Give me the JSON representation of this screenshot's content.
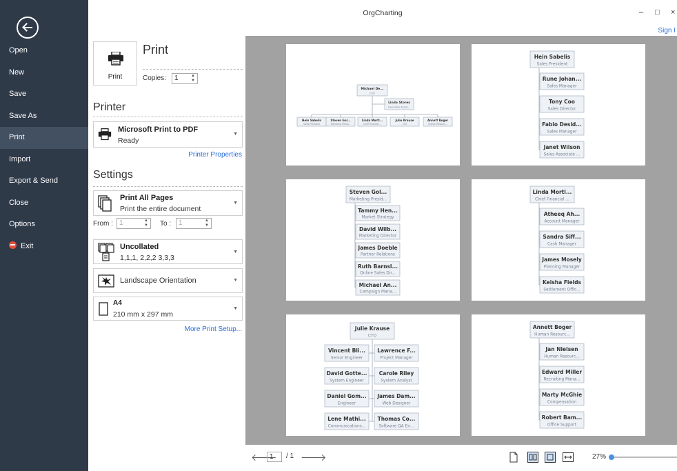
{
  "sidebar": {
    "items": [
      {
        "label": "Open"
      },
      {
        "label": "New"
      },
      {
        "label": "Save"
      },
      {
        "label": "Save As"
      },
      {
        "label": "Print",
        "active": true
      },
      {
        "label": "Import"
      },
      {
        "label": "Export & Send"
      },
      {
        "label": "Close"
      },
      {
        "label": "Options"
      },
      {
        "label": "Exit",
        "icon": "exit-icon"
      }
    ]
  },
  "window": {
    "title": "OrgCharting",
    "minimize": "–",
    "maximize": "□",
    "close": "×",
    "sign_in": "Sign I"
  },
  "print": {
    "button_label": "Print",
    "title": "Print",
    "copies_label": "Copies:",
    "copies_value": "1"
  },
  "printer": {
    "heading": "Printer",
    "name": "Microsoft Print to PDF",
    "status": "Ready",
    "properties_link": "Printer Properties"
  },
  "settings": {
    "heading": "Settings",
    "pages_title": "Print All Pages",
    "pages_sub": "Print the entire document",
    "from_label": "From :",
    "from_value": "1",
    "to_label": "To :",
    "to_value": "1",
    "collate_title": "Uncollated",
    "collate_sub": "1,1,1, 2,2,2 3,3,3",
    "orientation": "Landscape Orientation",
    "paper_title": "A4",
    "paper_sub": "210 mm x 297 mm",
    "more_link": "More Print Setup..."
  },
  "statusbar": {
    "page_value": "1",
    "page_total": "/ 1",
    "zoom_label": "27%",
    "zoom_fraction": 0.04
  },
  "accent": "#2a6fdb",
  "pages": [
    {
      "type": "tree",
      "nodes": [
        {
          "id": "a",
          "name": "Michael De...",
          "title": "CEO"
        },
        {
          "id": "b",
          "name": "Linda Stores",
          "title": "Executive Assist..."
        },
        {
          "id": "c",
          "name": "Hein Sabelis",
          "title": "Sales President"
        },
        {
          "id": "d",
          "name": "Steven Gol...",
          "title": "Marketing Presid..."
        },
        {
          "id": "e",
          "name": "Linda Mortl...",
          "title": "Chief Financial ..."
        },
        {
          "id": "f",
          "name": "Julie Krause",
          "title": "CTO"
        },
        {
          "id": "g",
          "name": "Annett Boger",
          "title": "Human Resourc..."
        }
      ]
    },
    {
      "type": "list",
      "head": {
        "name": "Hein Sabelis",
        "title": "Sales President"
      },
      "children": [
        {
          "name": "Rune Johan...",
          "title": "Sales Manager"
        },
        {
          "name": "Tony Coo",
          "title": "Sales Director"
        },
        {
          "name": "Fabio Desid...",
          "title": "Sales Manager"
        },
        {
          "name": "Janet Wilson",
          "title": "Sales Associate ..."
        }
      ]
    },
    {
      "type": "list",
      "head": {
        "name": "Steven Gol...",
        "title": "Marketing Presid..."
      },
      "children": [
        {
          "name": "Tammy Hen...",
          "title": "Market Strategy"
        },
        {
          "name": "David Wilb...",
          "title": "Marketing Director"
        },
        {
          "name": "James Doeble",
          "title": "Partner Relations"
        },
        {
          "name": "Ruth Barnsl...",
          "title": "Online Sales Dir..."
        },
        {
          "name": "Michael An...",
          "title": "Campaign Mana..."
        }
      ]
    },
    {
      "type": "list",
      "head": {
        "name": "Linda Mortl...",
        "title": "Chief Financial ..."
      },
      "children": [
        {
          "name": "Atheeq Ah...",
          "title": "Account Manager"
        },
        {
          "name": "Sandra Siff...",
          "title": "Cash Manager"
        },
        {
          "name": "James Mosely",
          "title": "Planning Manager"
        },
        {
          "name": "Keisha Fields",
          "title": "Settlement Offic..."
        }
      ]
    },
    {
      "type": "split",
      "head": {
        "name": "Julie Krause",
        "title": "CTO"
      },
      "left": [
        {
          "name": "Vincent Bli...",
          "title": "Senior Engineer"
        },
        {
          "name": "David Gotte...",
          "title": "System Engineer"
        },
        {
          "name": "Daniel Gom...",
          "title": "Engineer"
        },
        {
          "name": "Lene Mathi...",
          "title": "Communications..."
        }
      ],
      "right": [
        {
          "name": "Lawrence F...",
          "title": "Project Manager"
        },
        {
          "name": "Carole Riley",
          "title": "System Analyst"
        },
        {
          "name": "James Dam...",
          "title": "Web Designer"
        },
        {
          "name": "Thomas Co...",
          "title": "Software QA En..."
        }
      ]
    },
    {
      "type": "list",
      "head": {
        "name": "Annett Boger",
        "title": "Human Resourc..."
      },
      "children": [
        {
          "name": "Jan Nielsen",
          "title": "Human Resourc..."
        },
        {
          "name": "Edward Miller",
          "title": "Recruiting Mana..."
        },
        {
          "name": "Marty McGhie",
          "title": "Compensation"
        },
        {
          "name": "Robert Bam...",
          "title": "Office Support"
        }
      ]
    }
  ]
}
